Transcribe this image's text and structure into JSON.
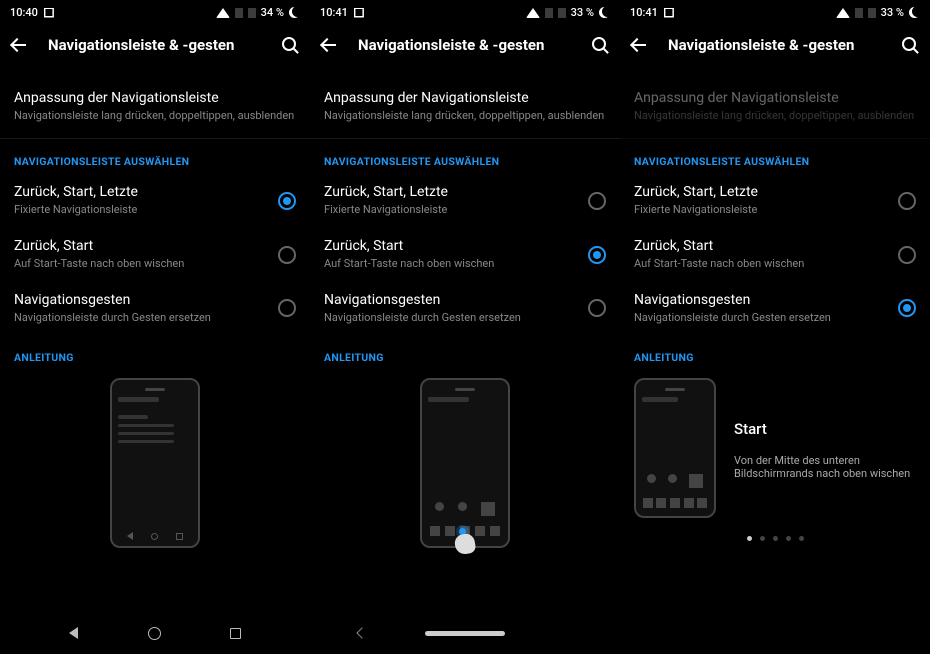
{
  "panels": [
    {
      "status": {
        "time": "10:40",
        "battery": "34 %"
      },
      "title": "Navigationsleiste & -gesten",
      "customize": {
        "title": "Anpassung der Navigationsleiste",
        "sub": "Navigationsleiste lang drücken, doppeltippen, ausblenden",
        "dimmed": false
      },
      "select_header": "NAVIGATIONSLEISTE AUSWÄHLEN",
      "options": [
        {
          "title": "Zurück, Start, Letzte",
          "sub": "Fixierte Navigationsleiste"
        },
        {
          "title": "Zurück, Start",
          "sub": "Auf Start-Taste nach oben wischen"
        },
        {
          "title": "Navigationsgesten",
          "sub": "Navigationsleiste durch Gesten ersetzen"
        }
      ],
      "tutorial_header": "ANLEITUNG"
    },
    {
      "status": {
        "time": "10:41",
        "battery": "33 %"
      },
      "title": "Navigationsleiste & -gesten",
      "customize": {
        "title": "Anpassung der Navigationsleiste",
        "sub": "Navigationsleiste lang drücken, doppeltippen, ausblenden",
        "dimmed": false
      },
      "select_header": "NAVIGATIONSLEISTE AUSWÄHLEN",
      "options": [
        {
          "title": "Zurück, Start, Letzte",
          "sub": "Fixierte Navigationsleiste"
        },
        {
          "title": "Zurück, Start",
          "sub": "Auf Start-Taste nach oben wischen"
        },
        {
          "title": "Navigationsgesten",
          "sub": "Navigationsleiste durch Gesten ersetzen"
        }
      ],
      "tutorial_header": "ANLEITUNG"
    },
    {
      "status": {
        "time": "10:41",
        "battery": "33 %"
      },
      "title": "Navigationsleiste & -gesten",
      "customize": {
        "title": "Anpassung der Navigationsleiste",
        "sub": "Navigationsleiste lang drücken, doppeltippen, ausblenden",
        "dimmed": true
      },
      "select_header": "NAVIGATIONSLEISTE AUSWÄHLEN",
      "options": [
        {
          "title": "Zurück, Start, Letzte",
          "sub": "Fixierte Navigationsleiste"
        },
        {
          "title": "Zurück, Start",
          "sub": "Auf Start-Taste nach oben wischen"
        },
        {
          "title": "Navigationsgesten",
          "sub": "Navigationsleiste durch Gesten ersetzen"
        }
      ],
      "tutorial_header": "ANLEITUNG",
      "tutorial_text": {
        "title": "Start",
        "sub": "Von der Mitte des unteren Bildschirmrands nach oben wischen"
      }
    }
  ]
}
